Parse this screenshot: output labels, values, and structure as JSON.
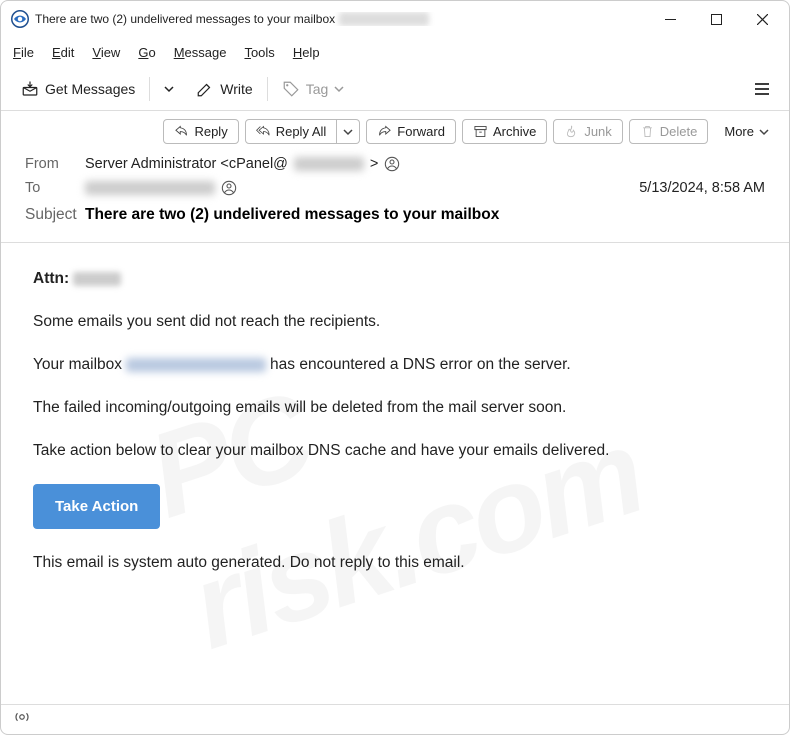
{
  "window": {
    "title": "There are two (2) undelivered messages to your mailbox"
  },
  "menubar": [
    "File",
    "Edit",
    "View",
    "Go",
    "Message",
    "Tools",
    "Help"
  ],
  "toolbar": {
    "get_messages": "Get Messages",
    "write": "Write",
    "tag": "Tag"
  },
  "actions": {
    "reply": "Reply",
    "reply_all": "Reply All",
    "forward": "Forward",
    "archive": "Archive",
    "junk": "Junk",
    "delete": "Delete",
    "more": "More"
  },
  "headers": {
    "from_label": "From",
    "from_value": "Server Administrator <cPanel@",
    "from_suffix": " >",
    "to_label": "To",
    "date": "5/13/2024, 8:58 AM",
    "subject_label": "Subject",
    "subject_value": "There are two (2) undelivered messages to your mailbox"
  },
  "body": {
    "attn": "Attn:",
    "line1": "Some emails you sent did not reach the recipients.",
    "line2a": "Your mailbox",
    "line2b": "has encountered a DNS error on the server.",
    "line3": "The failed incoming/outgoing emails will be deleted from the mail server soon.",
    "line4": "Take action below to clear your mailbox DNS cache and have your emails delivered.",
    "cta": "Take Action",
    "line5": "This email is system auto generated. Do not reply to this email."
  },
  "watermark": "PC risk.com"
}
